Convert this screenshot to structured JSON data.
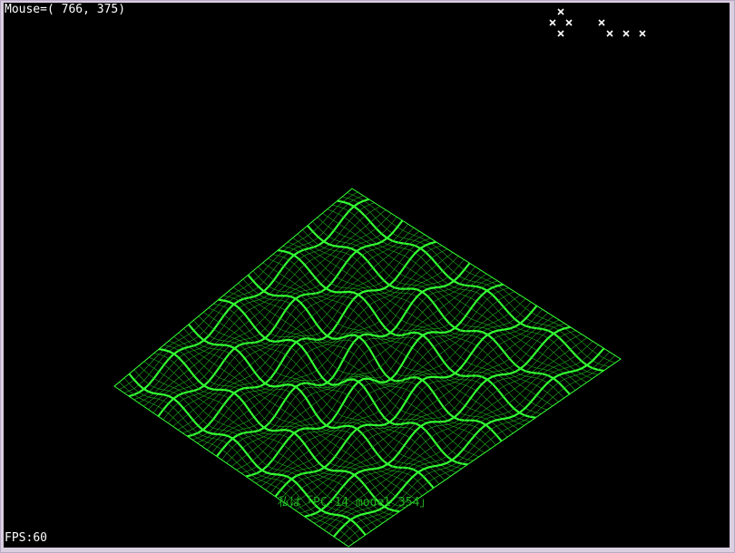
{
  "hud": {
    "mouse_label": "Mouse=",
    "mouse_x": "766",
    "mouse_y": "375",
    "fps_label": "FPS:",
    "fps_value": "60"
  },
  "caption": "私は「PC-14 model 354」",
  "colors": {
    "background": "#000000",
    "mesh": "#33ff33",
    "mesh_dim": "#1faa1f",
    "hud_text": "#ffffff",
    "caption": "#22b322",
    "markers": "#ffffff"
  },
  "markers": {
    "icon": "cross-marker-icon",
    "count": 8
  }
}
